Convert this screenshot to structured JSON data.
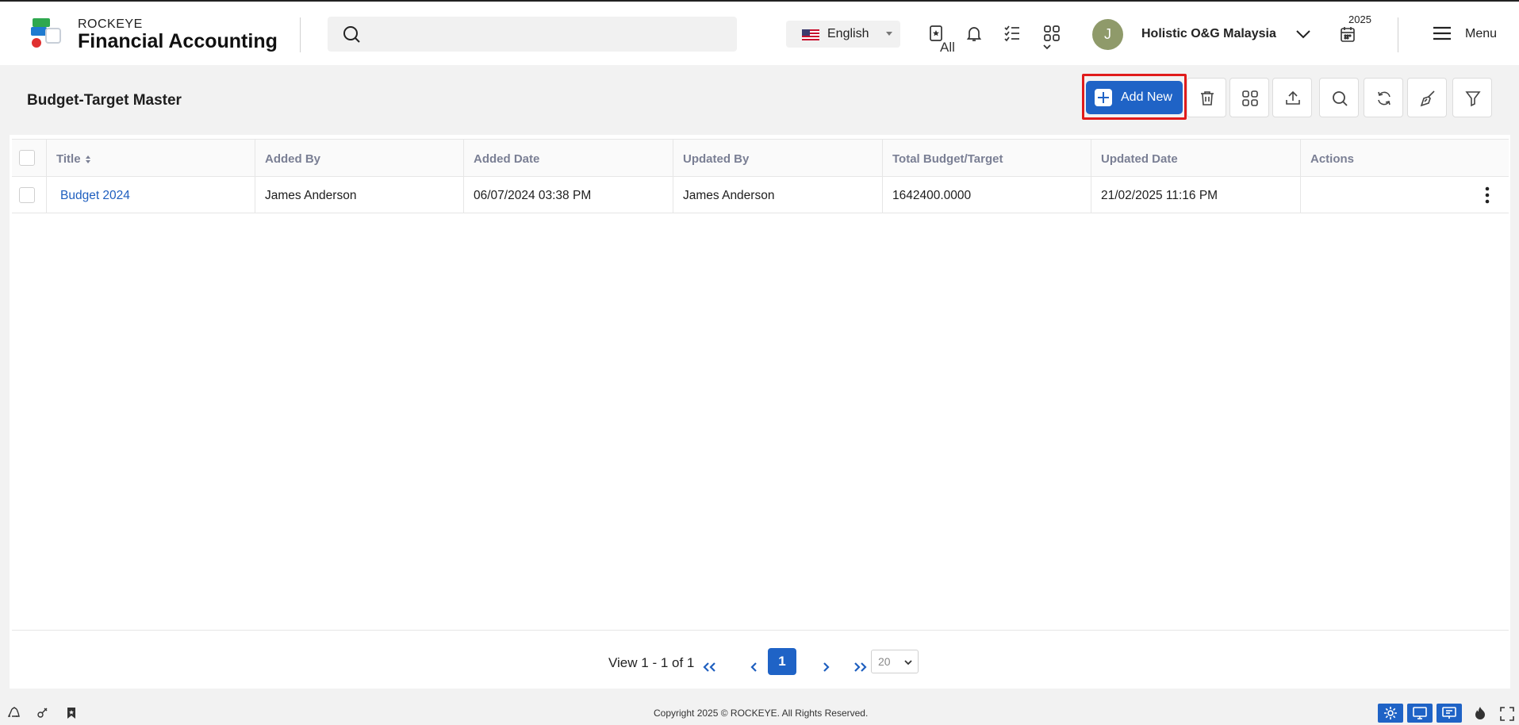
{
  "header": {
    "brand_top": "ROCKEYE",
    "brand_name": "Financial Accounting",
    "search_placeholder": "",
    "search_scope": "All",
    "language": "English",
    "user_initial": "J",
    "company": "Holistic O&G Malaysia",
    "year": "2025",
    "menu_label": "Menu"
  },
  "page": {
    "title": "Budget-Target Master",
    "add_new_label": "Add New"
  },
  "table": {
    "columns": [
      "Title",
      "Added By",
      "Added Date",
      "Updated By",
      "Total Budget/Target",
      "Updated Date",
      "Actions"
    ],
    "rows": [
      {
        "title": "Budget 2024",
        "added_by": "James Anderson",
        "added_date": "06/07/2024 03:38 PM",
        "updated_by": "James Anderson",
        "total": "1642400.0000",
        "updated_date": "21/02/2025 11:16 PM"
      }
    ]
  },
  "pagination": {
    "view_text": "View 1 - 1 of 1",
    "current_page": "1",
    "page_size": "20"
  },
  "footer": {
    "copyright": "Copyright 2025 © ROCKEYE. All Rights Reserved."
  },
  "colors": {
    "accent": "#1f63c6",
    "highlight": "#e01b1b",
    "link": "#1f5fbf"
  }
}
